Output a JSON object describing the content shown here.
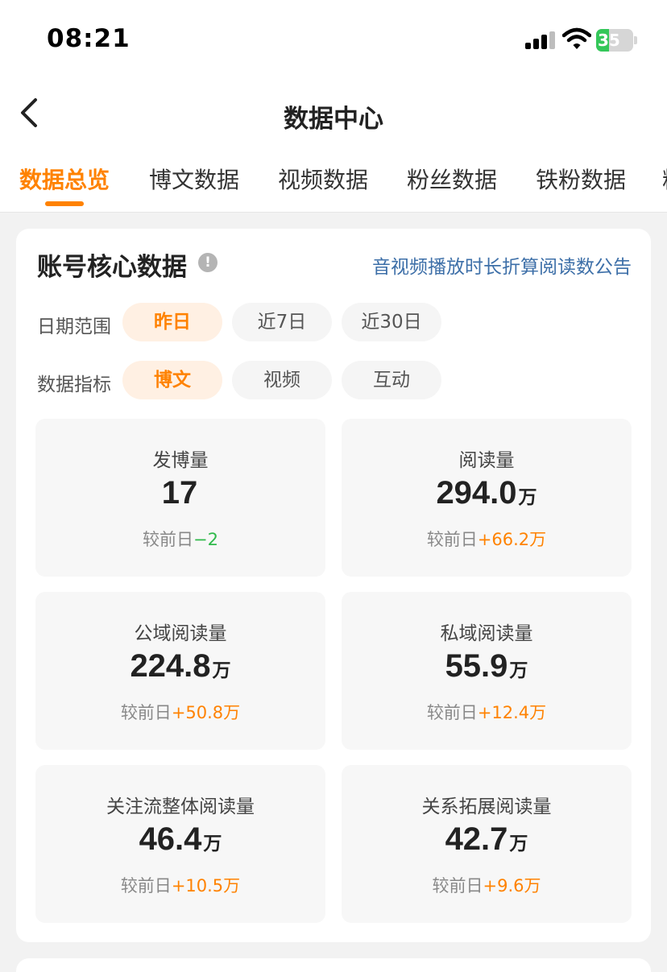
{
  "status_bar": {
    "time": "08:21",
    "battery": "35"
  },
  "nav": {
    "title": "数据中心"
  },
  "tabs": [
    {
      "label": "数据总览",
      "active": true
    },
    {
      "label": "博文数据",
      "active": false
    },
    {
      "label": "视频数据",
      "active": false
    },
    {
      "label": "粉丝数据",
      "active": false
    },
    {
      "label": "铁粉数据",
      "active": false
    },
    {
      "label": "粉",
      "active": false
    }
  ],
  "core": {
    "title": "账号核心数据",
    "notice_link": "音视频播放时长折算阅读数公告",
    "date_range": {
      "label": "日期范围",
      "options": [
        "昨日",
        "近7日",
        "近30日"
      ],
      "selected": "昨日"
    },
    "metric": {
      "label": "数据指标",
      "options": [
        "博文",
        "视频",
        "互动"
      ],
      "selected": "博文"
    },
    "stats": [
      {
        "label": "发博量",
        "value": "17",
        "unit": "",
        "compare_label": "较前日",
        "delta": "−2",
        "direction": "down"
      },
      {
        "label": "阅读量",
        "value": "294.0",
        "unit": "万",
        "compare_label": "较前日",
        "delta": "+66.2万",
        "direction": "up"
      },
      {
        "label": "公域阅读量",
        "value": "224.8",
        "unit": "万",
        "compare_label": "较前日",
        "delta": "+50.8万",
        "direction": "up"
      },
      {
        "label": "私域阅读量",
        "value": "55.9",
        "unit": "万",
        "compare_label": "较前日",
        "delta": "+12.4万",
        "direction": "up"
      },
      {
        "label": "关注流整体阅读量",
        "value": "46.4",
        "unit": "万",
        "compare_label": "较前日",
        "delta": "+10.5万",
        "direction": "up"
      },
      {
        "label": "关系拓展阅读量",
        "value": "42.7",
        "unit": "万",
        "compare_label": "较前日",
        "delta": "+9.6万",
        "direction": "up"
      }
    ]
  },
  "colors": {
    "accent": "#ff8200",
    "link": "#3d6fa8",
    "down": "#2fb94b",
    "battery": "#34c759"
  }
}
